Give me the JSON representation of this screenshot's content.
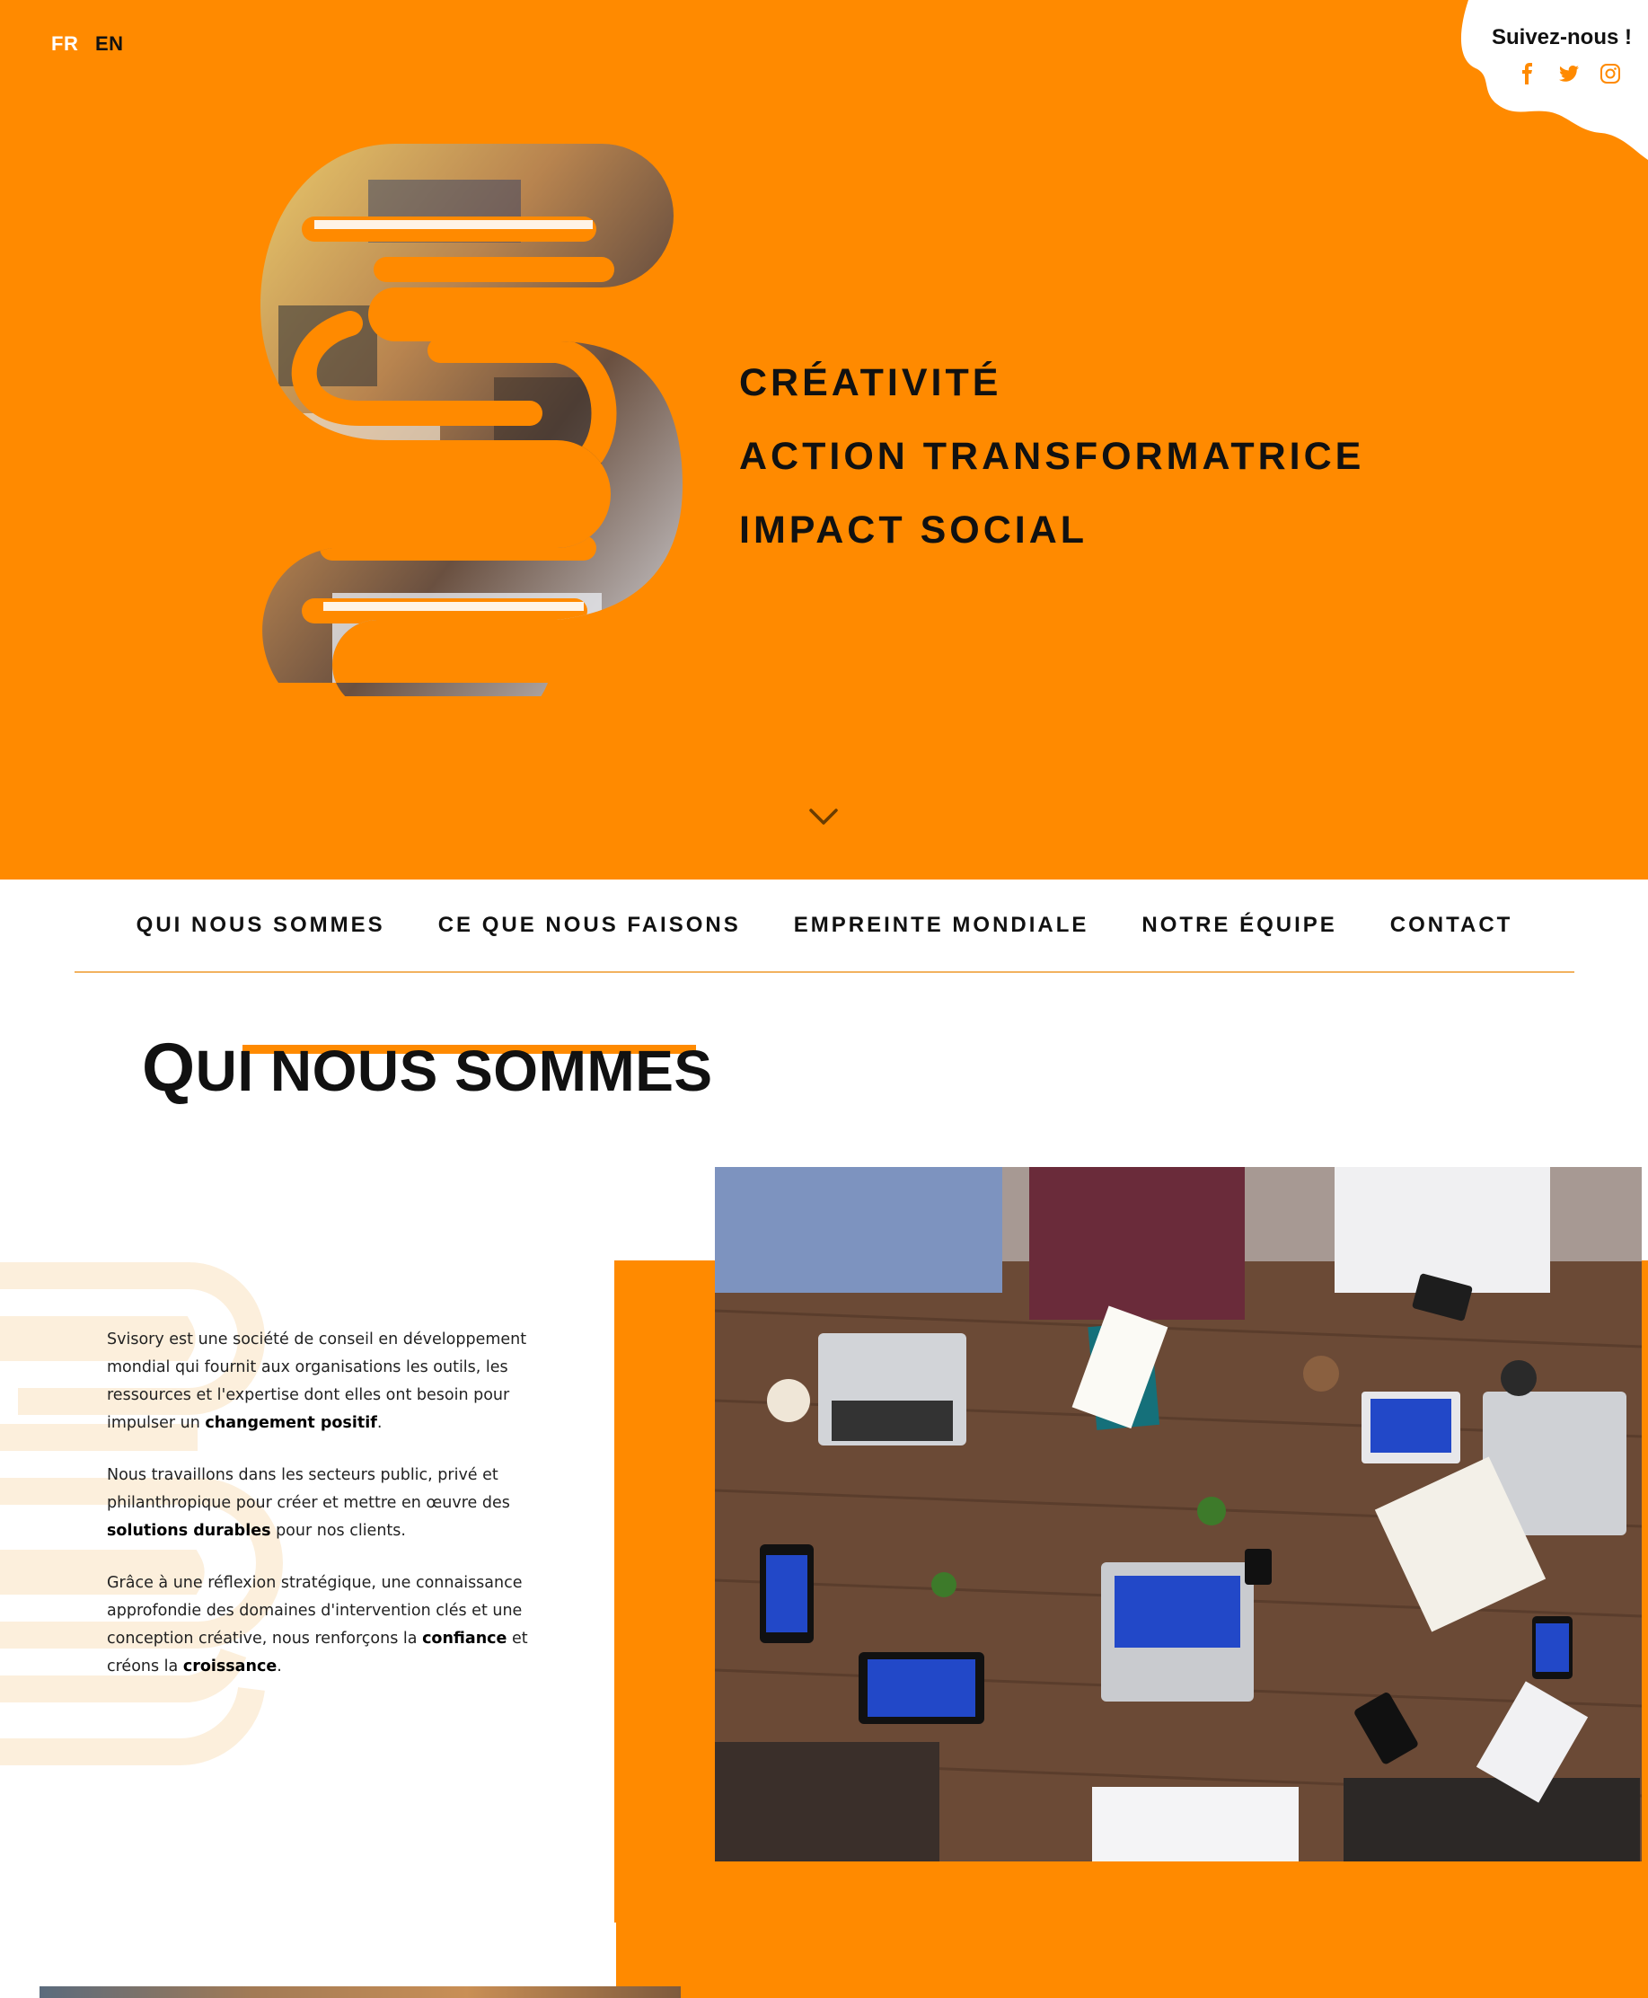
{
  "language": {
    "active": "FR",
    "inactive": "EN"
  },
  "follow": {
    "title": "Suivez-nous !",
    "icons": [
      "facebook-icon",
      "twitter-icon",
      "instagram-icon"
    ]
  },
  "hero": {
    "taglines": [
      "CRÉATIVITÉ",
      "ACTION TRANSFORMATRICE",
      "IMPACT SOCIAL"
    ]
  },
  "nav": {
    "items": [
      "QUI NOUS SOMMES",
      "CE QUE NOUS FAISONS",
      "EMPREINTE MONDIALE",
      "NOTRE ÉQUIPE",
      "CONTACT"
    ]
  },
  "section": {
    "title_first": "Q",
    "title_rest": "UI NOUS SOMMES",
    "paragraphs": [
      {
        "before": "Svisory est une société de conseil en développement mondial qui fournit aux organisations les outils, les ressources et l'expertise dont elles ont besoin pour impulser un ",
        "bold": "changement positif",
        "after": "."
      },
      {
        "before": "Nous travaillons dans les secteurs public, privé et philanthropique pour créer et mettre en œuvre des ",
        "bold": "solutions durables",
        "after": " pour nos clients."
      },
      {
        "before": "Grâce à une réflexion stratégique, une connaissance approfondie des domaines d'intervention clés et une conception créative, nous renforçons la ",
        "bold": "confiance",
        "after": " et créons la ",
        "bold2": "croissance",
        "after2": "."
      }
    ]
  },
  "colors": {
    "brand_orange": "#ff8a00",
    "text": "#111111"
  }
}
